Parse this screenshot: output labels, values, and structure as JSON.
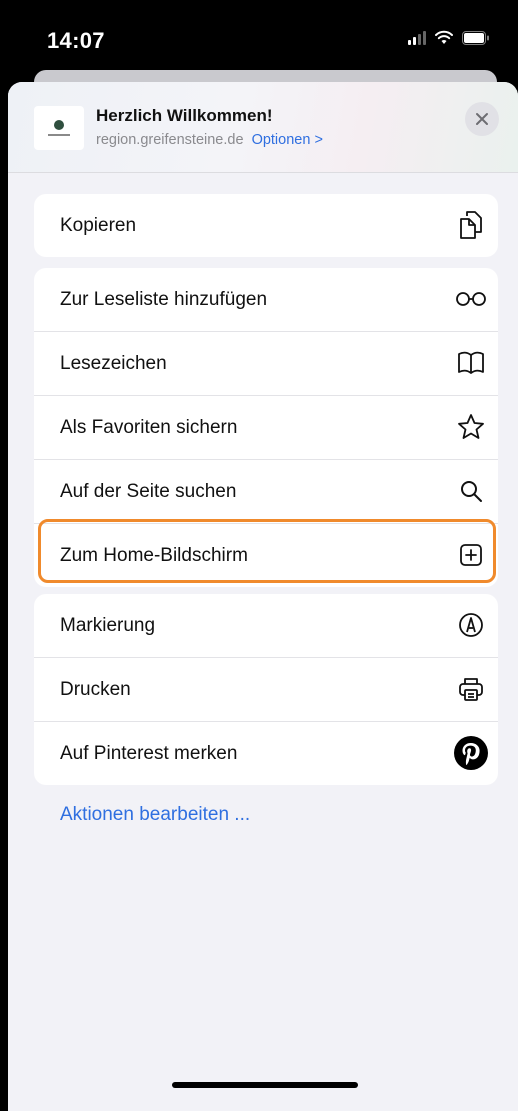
{
  "status_bar": {
    "time": "14:07",
    "icons": [
      "cellular-signal-icon",
      "wifi-icon",
      "battery-icon"
    ]
  },
  "share_header": {
    "title": "Herzlich Willkommen!",
    "domain": "region.greifensteine.de",
    "options_label": "Optionen >"
  },
  "groups": [
    {
      "items": [
        {
          "label": "Kopieren",
          "icon": "copy-icon"
        }
      ]
    },
    {
      "items": [
        {
          "label": "Zur Leseliste hinzufügen",
          "icon": "glasses-icon"
        },
        {
          "label": "Lesezeichen",
          "icon": "book-icon"
        },
        {
          "label": "Als Favoriten sichern",
          "icon": "star-icon"
        },
        {
          "label": "Auf der Seite suchen",
          "icon": "search-icon"
        },
        {
          "label": "Zum Home-Bildschirm",
          "icon": "plus-square-icon",
          "highlighted": true
        }
      ]
    },
    {
      "items": [
        {
          "label": "Markierung",
          "icon": "markup-icon"
        },
        {
          "label": "Drucken",
          "icon": "printer-icon"
        },
        {
          "label": "Auf Pinterest merken",
          "icon": "pinterest-icon"
        }
      ]
    }
  ],
  "edit_actions_label": "Aktionen bearbeiten ...",
  "colors": {
    "accent": "#2f6fe0",
    "highlight": "#f08a2c",
    "background": "#f2f2f7"
  }
}
